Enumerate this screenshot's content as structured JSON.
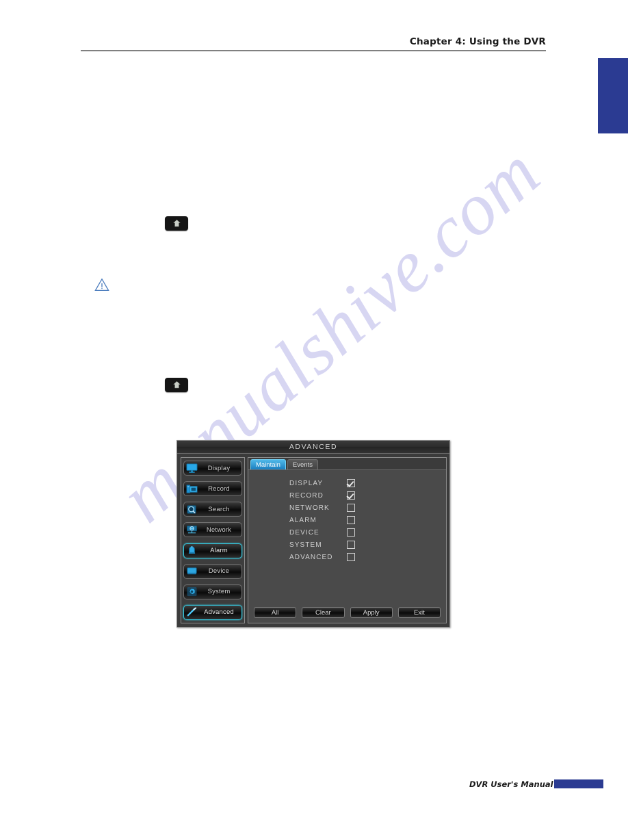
{
  "page": {
    "header_title": "Chapter 4: Using the DVR",
    "footer_text": "DVR User's Manual",
    "watermark": "manualshive.com",
    "accent_blue": "#2b3b92",
    "rule_color": "#808080"
  },
  "inline_icons": {
    "home_key_1": "home-key-icon",
    "home_key_2": "home-key-icon",
    "warning": "warning-triangle-icon"
  },
  "dvr": {
    "title": "ADVANCED",
    "sidebar": [
      {
        "label": "Display",
        "icon": "monitor-icon",
        "selected": false
      },
      {
        "label": "Record",
        "icon": "recorder-icon",
        "selected": false
      },
      {
        "label": "Search",
        "icon": "magnifier-icon",
        "selected": false
      },
      {
        "label": "Network",
        "icon": "globe-icon",
        "selected": false
      },
      {
        "label": "Alarm",
        "icon": "bell-icon",
        "selected": true
      },
      {
        "label": "Device",
        "icon": "hdd-icon",
        "selected": false
      },
      {
        "label": "System",
        "icon": "gear-icon",
        "selected": false
      },
      {
        "label": "Advanced",
        "icon": "screwdriver-icon",
        "selected": true
      }
    ],
    "tabs": [
      {
        "label": "Maintain",
        "active": true
      },
      {
        "label": "Events",
        "active": false
      }
    ],
    "checkboxes": [
      {
        "label": "DISPLAY",
        "checked": true
      },
      {
        "label": "RECORD",
        "checked": true
      },
      {
        "label": "NETWORK",
        "checked": false
      },
      {
        "label": "ALARM",
        "checked": false
      },
      {
        "label": "DEVICE",
        "checked": false
      },
      {
        "label": "SYSTEM",
        "checked": false
      },
      {
        "label": "ADVANCED",
        "checked": false
      }
    ],
    "buttons": [
      "All",
      "Clear",
      "Apply",
      "Exit"
    ],
    "colors": {
      "active_tab": "#1b7fc0",
      "selected_border": "#36c6dc",
      "panel_bg": "#4a4a4a",
      "dialog_bg": "#3b3b3b"
    }
  }
}
